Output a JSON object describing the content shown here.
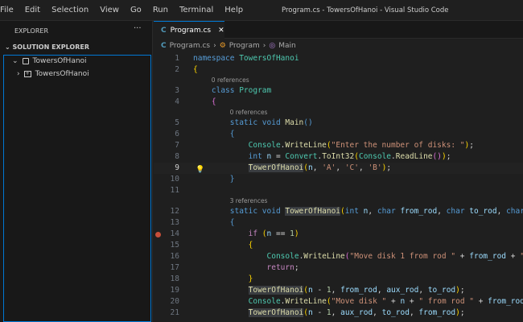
{
  "menu": [
    "File",
    "Edit",
    "Selection",
    "View",
    "Go",
    "Run",
    "Terminal",
    "Help"
  ],
  "window_title": "Program.cs - TowersOfHanoi - Visual Studio Code",
  "sidebar": {
    "header": "EXPLORER",
    "more": "···",
    "section": "SOLUTION EXPLORER",
    "items": [
      {
        "label": "TowersOfHanoi",
        "chevron": "⌄",
        "icon": "solution-icon"
      },
      {
        "label": "TowersOfHanoi",
        "chevron": "›",
        "icon": "project-icon"
      }
    ]
  },
  "tab": {
    "label": "Program.cs",
    "close": "✕"
  },
  "breadcrumb": [
    "Program.cs",
    "Program",
    "Main"
  ],
  "code": [
    {
      "n": "1",
      "t": [
        [
          "namespace ",
          "kw"
        ],
        [
          "TowersOfHanoi",
          "ty"
        ]
      ]
    },
    {
      "n": "2",
      "t": [
        [
          "{",
          "br"
        ]
      ]
    },
    {
      "lens": "0 references",
      "indent": "    "
    },
    {
      "n": "3",
      "t": [
        [
          "    class ",
          "kw"
        ],
        [
          "Program",
          "ty"
        ]
      ]
    },
    {
      "n": "4",
      "t": [
        [
          "    {",
          "pu"
        ]
      ]
    },
    {
      "lens": "0 references",
      "indent": "        "
    },
    {
      "n": "5",
      "t": [
        [
          "        static void ",
          "kw"
        ],
        [
          "Main",
          "fn"
        ],
        [
          "()",
          "kw"
        ]
      ]
    },
    {
      "n": "6",
      "t": [
        [
          "        {",
          "kw"
        ]
      ]
    },
    {
      "n": "7",
      "t": [
        [
          "            Console",
          "ty"
        ],
        [
          ".",
          "pl"
        ],
        [
          "WriteLine",
          "fn"
        ],
        [
          "(",
          "br"
        ],
        [
          "\"Enter the number of disks: \"",
          "st"
        ],
        [
          ")",
          "br"
        ],
        [
          ";",
          "pl"
        ]
      ]
    },
    {
      "n": "8",
      "t": [
        [
          "            int ",
          "kw"
        ],
        [
          "n",
          "pm"
        ],
        [
          " = ",
          "pl"
        ],
        [
          "Convert",
          "ty"
        ],
        [
          ".",
          "pl"
        ],
        [
          "ToInt32",
          "fn"
        ],
        [
          "(",
          "br"
        ],
        [
          "Console",
          "ty"
        ],
        [
          ".",
          "pl"
        ],
        [
          "ReadLine",
          "fn"
        ],
        [
          "()",
          "pu"
        ],
        [
          ")",
          "br"
        ],
        [
          ";",
          "pl"
        ]
      ]
    },
    {
      "n": "9",
      "cur": true,
      "bulb": true,
      "t": [
        [
          "            ",
          "pl"
        ],
        [
          "TowerOfHanoi",
          "fn hl"
        ],
        [
          "(",
          "br"
        ],
        [
          "n",
          "pm"
        ],
        [
          ", ",
          "pl"
        ],
        [
          "'A'",
          "st"
        ],
        [
          ", ",
          "pl"
        ],
        [
          "'C'",
          "st"
        ],
        [
          ", ",
          "pl"
        ],
        [
          "'B'",
          "st"
        ],
        [
          ")",
          "br"
        ],
        [
          ";",
          "pl"
        ]
      ]
    },
    {
      "n": "10",
      "t": [
        [
          "        }",
          "kw"
        ]
      ]
    },
    {
      "n": "11",
      "t": []
    },
    {
      "lens": "3 references",
      "indent": "        "
    },
    {
      "n": "12",
      "t": [
        [
          "        static void ",
          "kw"
        ],
        [
          "TowerOfHanoi",
          "fn hl"
        ],
        [
          "(",
          "br"
        ],
        [
          "int ",
          "kw"
        ],
        [
          "n",
          "pm"
        ],
        [
          ", ",
          "pl"
        ],
        [
          "char ",
          "kw"
        ],
        [
          "from_rod",
          "pm"
        ],
        [
          ", ",
          "pl"
        ],
        [
          "char ",
          "kw"
        ],
        [
          "to_rod",
          "pm"
        ],
        [
          ", ",
          "pl"
        ],
        [
          "char",
          "kw"
        ]
      ]
    },
    {
      "n": "13",
      "t": [
        [
          "        {",
          "kw"
        ]
      ]
    },
    {
      "n": "14",
      "bp": true,
      "t": [
        [
          "            if ",
          "ct"
        ],
        [
          "(",
          "br"
        ],
        [
          "n",
          "pm"
        ],
        [
          " == ",
          "pl"
        ],
        [
          "1",
          "nu"
        ],
        [
          ")",
          "br"
        ]
      ]
    },
    {
      "n": "15",
      "t": [
        [
          "            {",
          "br"
        ]
      ]
    },
    {
      "n": "16",
      "t": [
        [
          "                Console",
          "ty"
        ],
        [
          ".",
          "pl"
        ],
        [
          "WriteLine",
          "fn"
        ],
        [
          "(",
          "pu"
        ],
        [
          "\"Move disk 1 from rod \"",
          "st"
        ],
        [
          " + ",
          "pl"
        ],
        [
          "from_rod",
          "pm"
        ],
        [
          " + ",
          "pl"
        ],
        [
          "\"",
          "st"
        ]
      ]
    },
    {
      "n": "17",
      "t": [
        [
          "                return",
          "ct"
        ],
        [
          ";",
          "pl"
        ]
      ]
    },
    {
      "n": "18",
      "t": [
        [
          "            }",
          "br"
        ]
      ]
    },
    {
      "n": "19",
      "t": [
        [
          "            ",
          "pl"
        ],
        [
          "TowerOfHanoi",
          "fn hl"
        ],
        [
          "(",
          "br"
        ],
        [
          "n",
          "pm"
        ],
        [
          " - ",
          "pl"
        ],
        [
          "1",
          "nu"
        ],
        [
          ", ",
          "pl"
        ],
        [
          "from_rod",
          "pm"
        ],
        [
          ", ",
          "pl"
        ],
        [
          "aux_rod",
          "pm"
        ],
        [
          ", ",
          "pl"
        ],
        [
          "to_rod",
          "pm"
        ],
        [
          ")",
          "br"
        ],
        [
          ";",
          "pl"
        ]
      ]
    },
    {
      "n": "20",
      "t": [
        [
          "            Console",
          "ty"
        ],
        [
          ".",
          "pl"
        ],
        [
          "WriteLine",
          "fn"
        ],
        [
          "(",
          "br"
        ],
        [
          "\"Move disk \"",
          "st"
        ],
        [
          " + ",
          "pl"
        ],
        [
          "n",
          "pm"
        ],
        [
          " + ",
          "pl"
        ],
        [
          "\" from rod \"",
          "st"
        ],
        [
          " + ",
          "pl"
        ],
        [
          "from_rod",
          "pm"
        ]
      ]
    },
    {
      "n": "21",
      "t": [
        [
          "            ",
          "pl"
        ],
        [
          "TowerOfHanoi",
          "fn hl"
        ],
        [
          "(",
          "br"
        ],
        [
          "n",
          "pm"
        ],
        [
          " - ",
          "pl"
        ],
        [
          "1",
          "nu"
        ],
        [
          ", ",
          "pl"
        ],
        [
          "aux_rod",
          "pm"
        ],
        [
          ", ",
          "pl"
        ],
        [
          "to_rod",
          "pm"
        ],
        [
          ", ",
          "pl"
        ],
        [
          "from_rod",
          "pm"
        ],
        [
          ")",
          "br"
        ],
        [
          ";",
          "pl"
        ]
      ]
    }
  ]
}
